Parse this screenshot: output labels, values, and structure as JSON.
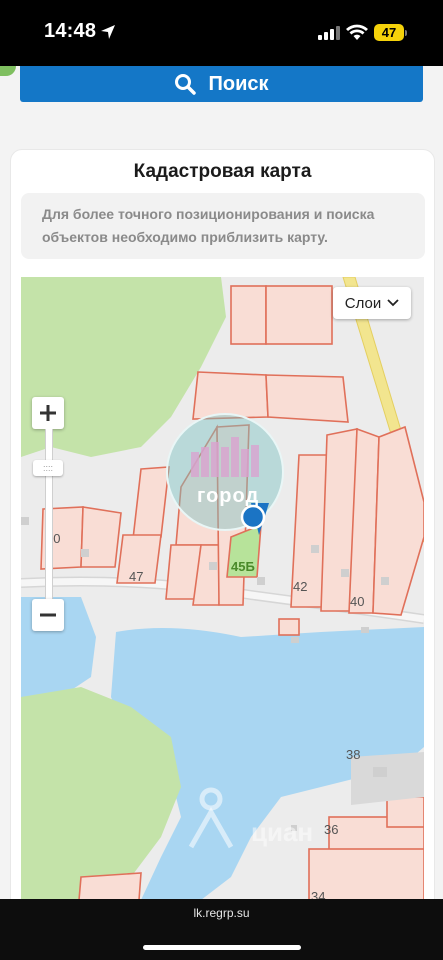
{
  "status_bar": {
    "time": "14:48",
    "battery": "47",
    "icons": [
      "location-arrow-icon",
      "cellular-signal-icon",
      "wifi-icon",
      "battery-icon"
    ]
  },
  "search": {
    "label": "Поиск",
    "icon": "search-icon",
    "color": "#1477c7"
  },
  "card": {
    "title": "Кадастровая карта",
    "hint": "Для более точного позиционирования и поиска объектов необходимо приблизить карту."
  },
  "map": {
    "layers_label": "Слои",
    "zoom_in_icon": "plus-icon",
    "zoom_out_icon": "minus-icon",
    "watermark": "город",
    "watermark2": "циан",
    "house_numbers": [
      "50",
      "47",
      "45Б",
      "42",
      "40",
      "38",
      "36",
      "34"
    ],
    "colors": {
      "parcel_fill": "#f9ddd5",
      "parcel_border": "#e0705a",
      "green": "#c4e3a9",
      "water": "#a9d6f2",
      "road": "#f2e58f",
      "marker": "#1b74c4"
    }
  },
  "browser": {
    "url": "lk.regrp.su"
  }
}
